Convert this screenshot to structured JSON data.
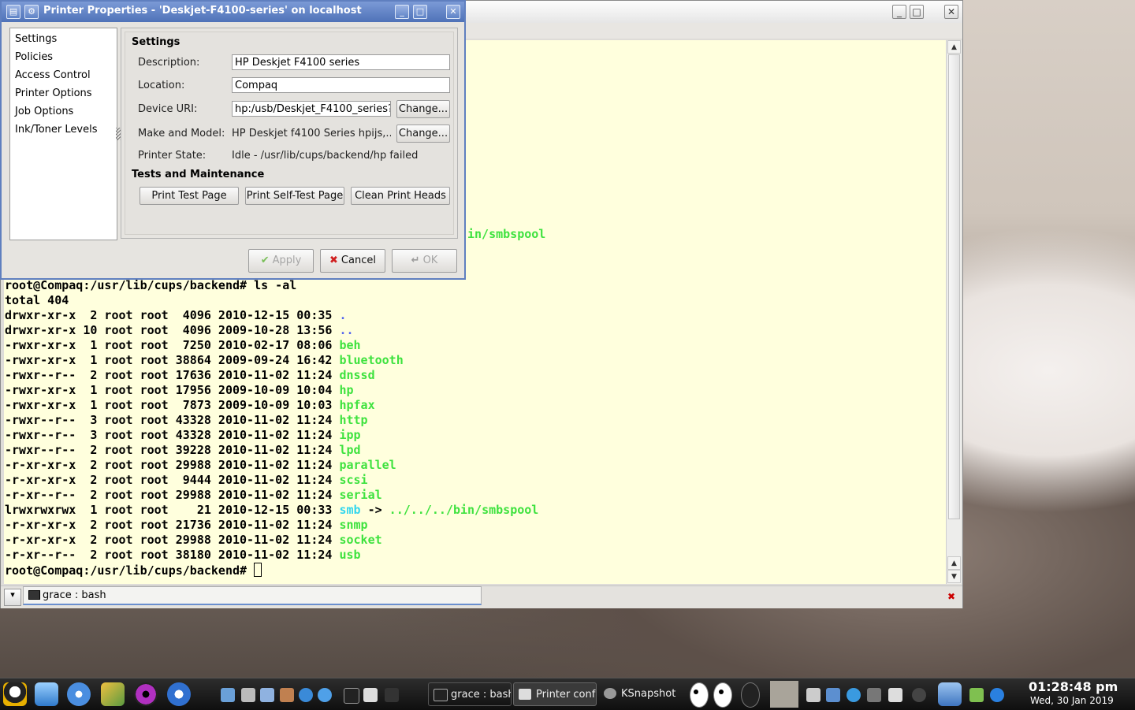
{
  "terminal": {
    "smb_fragment": "in/smbspool",
    "lines": [
      {
        "text": "root@Compaq:/usr/lib/cups/backend# ls -al"
      },
      {
        "text": "total 404"
      },
      {
        "prefix": "drwxr-xr-x  2 root root  4096 2010-12-15 00:35 ",
        "name": ".",
        "kind": "dir"
      },
      {
        "prefix": "drwxr-xr-x 10 root root  4096 2009-10-28 13:56 ",
        "name": "..",
        "kind": "dir"
      },
      {
        "prefix": "-rwxr-xr-x  1 root root  7250 2010-02-17 08:06 ",
        "name": "beh",
        "kind": "exe"
      },
      {
        "prefix": "-rwxr-xr-x  1 root root 38864 2009-09-24 16:42 ",
        "name": "bluetooth",
        "kind": "exe"
      },
      {
        "prefix": "-rwxr--r--  2 root root 17636 2010-11-02 11:24 ",
        "name": "dnssd",
        "kind": "exe"
      },
      {
        "prefix": "-rwxr-xr-x  1 root root 17956 2009-10-09 10:04 ",
        "name": "hp",
        "kind": "exe"
      },
      {
        "prefix": "-rwxr-xr-x  1 root root  7873 2009-10-09 10:03 ",
        "name": "hpfax",
        "kind": "exe"
      },
      {
        "prefix": "-rwxr--r--  3 root root 43328 2010-11-02 11:24 ",
        "name": "http",
        "kind": "exe"
      },
      {
        "prefix": "-rwxr--r--  3 root root 43328 2010-11-02 11:24 ",
        "name": "ipp",
        "kind": "exe"
      },
      {
        "prefix": "-rwxr--r--  2 root root 39228 2010-11-02 11:24 ",
        "name": "lpd",
        "kind": "exe"
      },
      {
        "prefix": "-r-xr-xr-x  2 root root 29988 2010-11-02 11:24 ",
        "name": "parallel",
        "kind": "exe"
      },
      {
        "prefix": "-r-xr-xr-x  2 root root  9444 2010-11-02 11:24 ",
        "name": "scsi",
        "kind": "exe"
      },
      {
        "prefix": "-r-xr--r--  2 root root 29988 2010-11-02 11:24 ",
        "name": "serial",
        "kind": "exe"
      },
      {
        "prefix": "lrwxrwxrwx  1 root root    21 2010-12-15 00:33 ",
        "name": "smb",
        "kind": "lnk",
        "arrow": " -> ",
        "target": "../../../bin/smbspool"
      },
      {
        "prefix": "-r-xr-xr-x  2 root root 21736 2010-11-02 11:24 ",
        "name": "snmp",
        "kind": "exe"
      },
      {
        "prefix": "-r-xr-xr-x  2 root root 29988 2010-11-02 11:24 ",
        "name": "socket",
        "kind": "exe"
      },
      {
        "prefix": "-r-xr--r--  2 root root 38180 2010-11-02 11:24 ",
        "name": "usb",
        "kind": "exe"
      },
      {
        "text": "root@Compaq:/usr/lib/cups/backend# ",
        "cursor": true
      }
    ],
    "tab_label": "grace : bash"
  },
  "dialog": {
    "title": "Printer Properties - 'Deskjet-F4100-series' on localhost",
    "sidebar": [
      "Settings",
      "Policies",
      "Access Control",
      "Printer Options",
      "Job Options",
      "Ink/Toner Levels"
    ],
    "settings_header": "Settings",
    "description_label": "Description:",
    "description_value": "HP Deskjet F4100 series",
    "location_label": "Location:",
    "location_value": "Compaq",
    "device_uri_label": "Device URI:",
    "device_uri_value": "hp:/usb/Deskjet_F4100_series?s",
    "make_model_label": "Make and Model:",
    "make_model_value": "HP Deskjet f4100 Series hpijs,...",
    "printer_state_label": "Printer State:",
    "printer_state_value": "Idle - /usr/lib/cups/backend/hp failed",
    "change_label": "Change...",
    "tests_header": "Tests and Maintenance",
    "print_test_page": "Print Test Page",
    "print_self_test_page": "Print Self-Test Page",
    "clean_print_heads": "Clean Print Heads",
    "apply": "Apply",
    "cancel": "Cancel",
    "ok": "OK"
  },
  "taskbar": {
    "tasks": [
      "grace : bash",
      "Printer conf",
      "KSnapshot"
    ],
    "clock_time": "01:28:48 pm",
    "clock_date": "Wed, 30 Jan 2019"
  },
  "colors": {
    "terminal_bg": "#ffffdd",
    "dir": "#5566ee",
    "exe": "#3ee23e",
    "link": "#33d6ee",
    "dialog_title": "#4f72b8"
  }
}
